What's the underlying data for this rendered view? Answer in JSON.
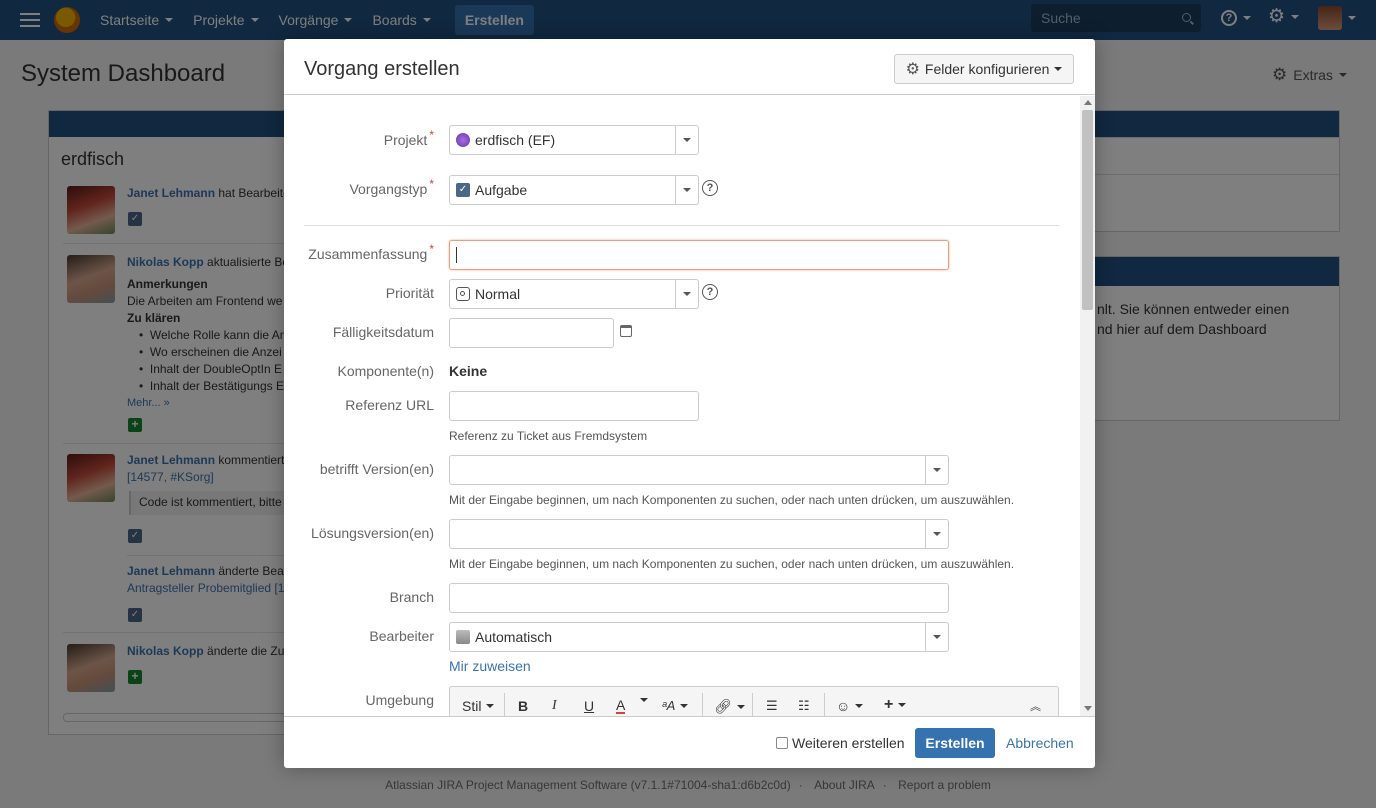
{
  "nav": {
    "items": [
      "Startseite",
      "Projekte",
      "Vorgänge",
      "Boards"
    ],
    "create_label": "Erstellen",
    "search_placeholder": "Suche"
  },
  "dashboard": {
    "title": "System Dashboard",
    "extras_label": "Extras",
    "gadget_title": "erdfisch",
    "activities": [
      {
        "user": "Janet Lehmann",
        "text": " hat Bearbeitet"
      },
      {
        "user": "Nikolas Kopp",
        "text": " aktualisierte Be",
        "heading": "Anmerkungen",
        "body": "Die Arbeiten am Frontend we",
        "heading2": "Zu klären",
        "bullets": [
          "Welche Rolle kann die An",
          "Wo erscheinen die Anzei",
          "Inhalt der DoubleOptIn E",
          "Inhalt der Bestätigungs E"
        ],
        "more": "Mehr... »"
      },
      {
        "user": "Janet Lehmann",
        "text": " kommentiert",
        "ref": "[14577, #KSorg]",
        "quote": "Code ist kommentiert, bitte"
      },
      {
        "user": "Janet Lehmann",
        "text": " änderte Bea",
        "ref": "Antragsteller Probemitglied [1"
      },
      {
        "user": "Nikolas Kopp",
        "text": " änderte die Zu"
      }
    ],
    "side_text_1": "nlt. Sie können entweder einen",
    "side_text_2": "nd hier auf dem Dashboard"
  },
  "dialog": {
    "title": "Vorgang erstellen",
    "configure_label": "Felder konfigurieren",
    "fields": {
      "projekt": {
        "label": "Projekt",
        "value": "erdfisch (EF)"
      },
      "vorgangstyp": {
        "label": "Vorgangstyp",
        "value": "Aufgabe"
      },
      "zusammenfassung": {
        "label": "Zusammenfassung",
        "value": ""
      },
      "prioritaet": {
        "label": "Priorität",
        "value": "Normal"
      },
      "faelligkeitsdatum": {
        "label": "Fälligkeitsdatum",
        "value": ""
      },
      "komponenten": {
        "label": "Komponente(n)",
        "value": "Keine"
      },
      "referenz_url": {
        "label": "Referenz URL",
        "value": "",
        "hint": "Referenz zu Ticket aus Fremdsystem"
      },
      "betrifft_version": {
        "label": "betrifft Version(en)",
        "value": "",
        "hint": "Mit der Eingabe beginnen, um nach Komponenten zu suchen, oder nach unten drücken, um auszuwählen."
      },
      "loesungsversion": {
        "label": "Lösungsversion(en)",
        "value": "",
        "hint": "Mit der Eingabe beginnen, um nach Komponenten zu suchen, oder nach unten drücken, um auszuwählen."
      },
      "branch": {
        "label": "Branch",
        "value": ""
      },
      "bearbeiter": {
        "label": "Bearbeiter",
        "value": "Automatisch",
        "assign_me": "Mir zuweisen"
      },
      "umgebung": {
        "label": "Umgebung",
        "toolbar_style": "Stil"
      }
    },
    "footer": {
      "more_label": "Weiteren erstellen",
      "submit_label": "Erstellen",
      "cancel_label": "Abbrechen"
    }
  },
  "footer": {
    "version": "Atlassian JIRA Project Management Software (v7.1.1#71004-sha1:d6b2c0d)",
    "about": "About JIRA",
    "report": "Report a problem"
  },
  "colors": {
    "nav_bg": "#205081",
    "primary": "#3572b0",
    "link": "#3b73af",
    "required": "#d04437"
  }
}
